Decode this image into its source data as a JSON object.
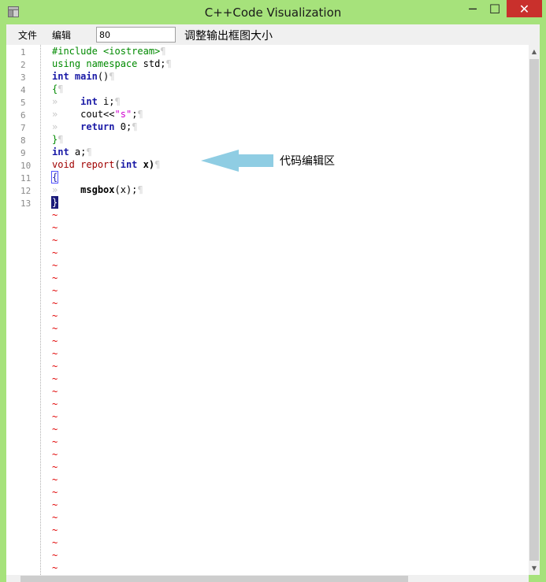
{
  "window": {
    "title": "C++Code Visualization",
    "minimize": "─",
    "maximize": "☐",
    "close": "✕"
  },
  "menu": {
    "file": "文件",
    "edit": "编辑"
  },
  "size_input": {
    "value": "80"
  },
  "size_label": "调整输出框图大小",
  "editor": {
    "line_numbers": [
      "1",
      "2",
      "3",
      "4",
      "5",
      "6",
      "7",
      "8",
      "9",
      "10",
      "11",
      "12",
      "13"
    ],
    "tilde": "~",
    "pilcrow": "¶",
    "tab_marker": "»",
    "tokens": {
      "l1": "#include <iostream>",
      "l2a": "using",
      "l2b": "namespace",
      "l2c": " std;",
      "l3a": "int",
      "l3b": "main",
      "l3c": "()",
      "l4": "{",
      "l5a": "int",
      "l5b": " i;",
      "l6a": "cout<<",
      "l6b": "\"s\"",
      "l6c": ";",
      "l7a": "return",
      "l7b": " 0;",
      "l8": "}",
      "l9a": "int",
      "l9b": " a;",
      "l10a": "void",
      "l10b": "report",
      "l10c": "(",
      "l10d": "int",
      "l10e": " x)",
      "l11": "{",
      "l12a": "msgbox",
      "l12b": "(x);",
      "l13": "}"
    }
  },
  "annotation": {
    "label": "代码编辑区",
    "arrow_color": "#8fcde3"
  },
  "colors": {
    "chrome": "#a6e27b",
    "keyword": "#1a1aa6",
    "preprocessor": "#008a00",
    "string": "#d000d0",
    "function": "#a00000",
    "tilde": "#e00000",
    "close_button": "#c9302c"
  }
}
